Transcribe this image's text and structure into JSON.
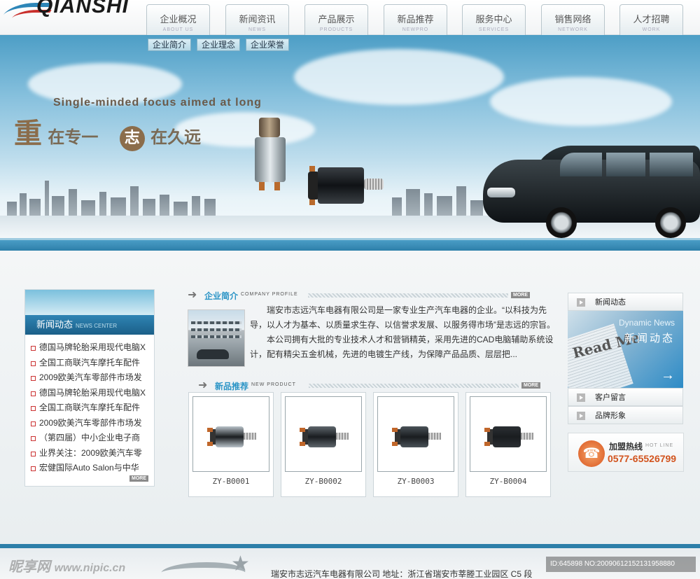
{
  "logo": {
    "text": "QIANSHI"
  },
  "nav": [
    {
      "cn": "企业概况",
      "en": "ABOUT US"
    },
    {
      "cn": "新闻资讯",
      "en": "NEWS"
    },
    {
      "cn": "产品展示",
      "en": "PRODUCTS"
    },
    {
      "cn": "新品推荐",
      "en": "NEWPRO"
    },
    {
      "cn": "服务中心",
      "en": "SERVICES"
    },
    {
      "cn": "销售网络",
      "en": "NETWORK"
    },
    {
      "cn": "人才招聘",
      "en": "WORK"
    }
  ],
  "subnav": [
    "企业简介",
    "企业理念",
    "企业荣誉"
  ],
  "banner": {
    "slogan_en": "Single-minded focus aimed at long",
    "slogan_cn_1": "重",
    "slogan_cn_2": "在专一",
    "slogan_cn_3": "志",
    "slogan_cn_4": "在久远"
  },
  "news": {
    "title": "新闻动态",
    "title_en": "NEWS CENTER",
    "items": [
      "德国马牌轮胎采用现代电脑X",
      "全国工商联汽车摩托车配件",
      "2009欧美汽车零部件市场发",
      "德国马牌轮胎采用现代电脑X",
      "全国工商联汽车摩托车配件",
      "2009欧美汽车零部件市场发",
      "（第四届）中小企业电子商",
      "业界关注：2009欧美汽车零",
      "宏健国际Auto Salon与中华"
    ],
    "more": "MORE"
  },
  "profile": {
    "title": "企业简介",
    "title_en": "COMPANY PROFILE",
    "more": "MORE",
    "para1": "瑞安市志远汽车电器有限公司是一家专业生产汽车电器的企业。“以科技为先导，以人才为基本、以质量求生存、以信誉求发展、以服务得市场”是志远的宗旨。",
    "para2": "本公司拥有大批的专业技术人才和营销精英，采用先进的CAD电脑辅助系统设计，配有精尖五金机械，先进的电镀生产线，为保障产品品质、层层把..."
  },
  "newpro": {
    "title": "新品推荐",
    "title_en": "NEW PRODUCT",
    "more": "MORE",
    "items": [
      {
        "label": "ZY-B0001",
        "color": "#b9c3ca"
      },
      {
        "label": "ZY-B0002",
        "color": "#5e666c"
      },
      {
        "label": "ZY-B0003",
        "color": "#4a5258"
      },
      {
        "label": "ZY-B0004",
        "color": "#2b2f33"
      }
    ]
  },
  "right": {
    "news_btn": "新闻动态",
    "panel_en": "Dynamic News",
    "panel_cn": "新闻动态",
    "panel_read": "Read Me",
    "panel_go": "→",
    "msg_btn": "客户留言",
    "brand_btn": "品牌形象",
    "hotline_label": "加盟热线",
    "hotline_en": "HOT LINE",
    "hotline_num": "0577-65526799"
  },
  "footer": {
    "info": "瑞安市志远汽车电器有限公司  地址：浙江省瑞安市莘塍工业园区 C5 段"
  },
  "watermark": {
    "brand": "昵享网",
    "site": "www.nipic.cn"
  },
  "image_id": "ID:645898 NO:20090612152131958880"
}
